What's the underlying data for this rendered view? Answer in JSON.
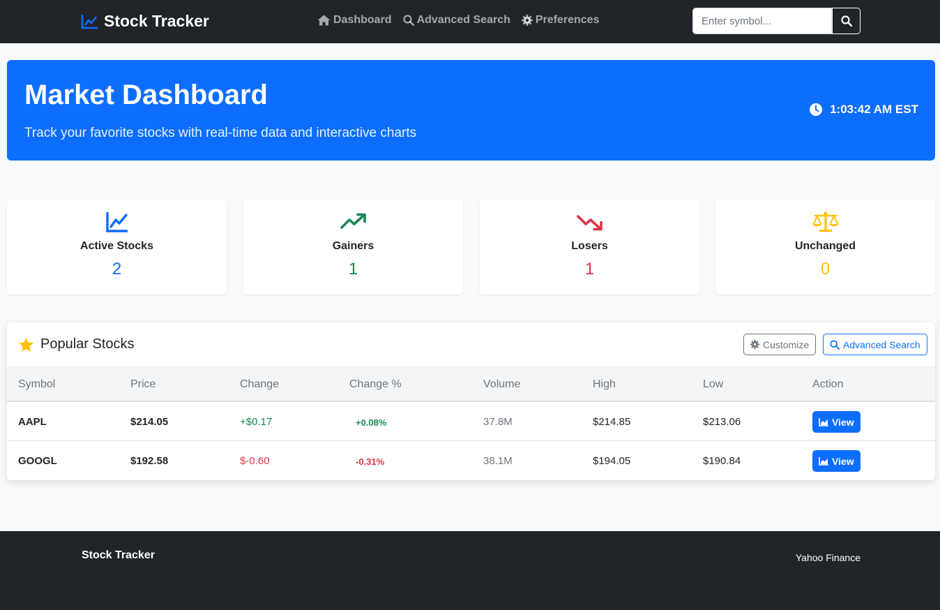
{
  "app": {
    "brand": "Stock Tracker",
    "brand_icon": "chart-line-icon"
  },
  "nav": {
    "items": [
      {
        "label": "Dashboard",
        "icon": "home-icon"
      },
      {
        "label": "Advanced Search",
        "icon": "search-icon"
      },
      {
        "label": "Preferences",
        "icon": "gear-icon"
      }
    ],
    "search": {
      "placeholder": "Enter symbol...",
      "value": ""
    }
  },
  "hero": {
    "title": "Market Dashboard",
    "subtitle": "Track your favorite stocks with real-time data and interactive charts",
    "clock": "1:03:42 AM EST",
    "clock_icon": "clock-icon"
  },
  "stats": [
    {
      "label": "Active Stocks",
      "value": "2",
      "icon": "chart-line-icon",
      "color": "#0d6efd"
    },
    {
      "label": "Gainers",
      "value": "1",
      "icon": "trend-up-icon",
      "color": "#198754"
    },
    {
      "label": "Losers",
      "value": "1",
      "icon": "trend-down-icon",
      "color": "#dc3545"
    },
    {
      "label": "Unchanged",
      "value": "0",
      "icon": "scale-balanced-icon",
      "color": "#ffc107"
    }
  ],
  "popular": {
    "title": "Popular Stocks",
    "title_icon": "star-icon",
    "customize_label": "Customize",
    "advanced_search_label": "Advanced Search",
    "columns": [
      "Symbol",
      "Price",
      "Change",
      "Change %",
      "Volume",
      "High",
      "Low",
      "Action"
    ],
    "rows": [
      {
        "symbol": "AAPL",
        "price": "$214.05",
        "change": "+$0.17",
        "change_pct": "+0.08%",
        "volume": "37.8M",
        "high": "$214.85",
        "low": "$213.06",
        "action": "View",
        "direction": "up"
      },
      {
        "symbol": "GOOGL",
        "price": "$192.58",
        "change": "$-0.60",
        "change_pct": "-0.31%",
        "volume": "38.1M",
        "high": "$194.05",
        "low": "$190.84",
        "action": "View",
        "direction": "down"
      }
    ]
  },
  "footer": {
    "brand": "Stock Tracker",
    "right_text": "Yahoo Finance"
  },
  "colors": {
    "primary": "#0d6efd",
    "success": "#198754",
    "danger": "#dc3545",
    "warning": "#ffc107",
    "dark": "#212529"
  }
}
